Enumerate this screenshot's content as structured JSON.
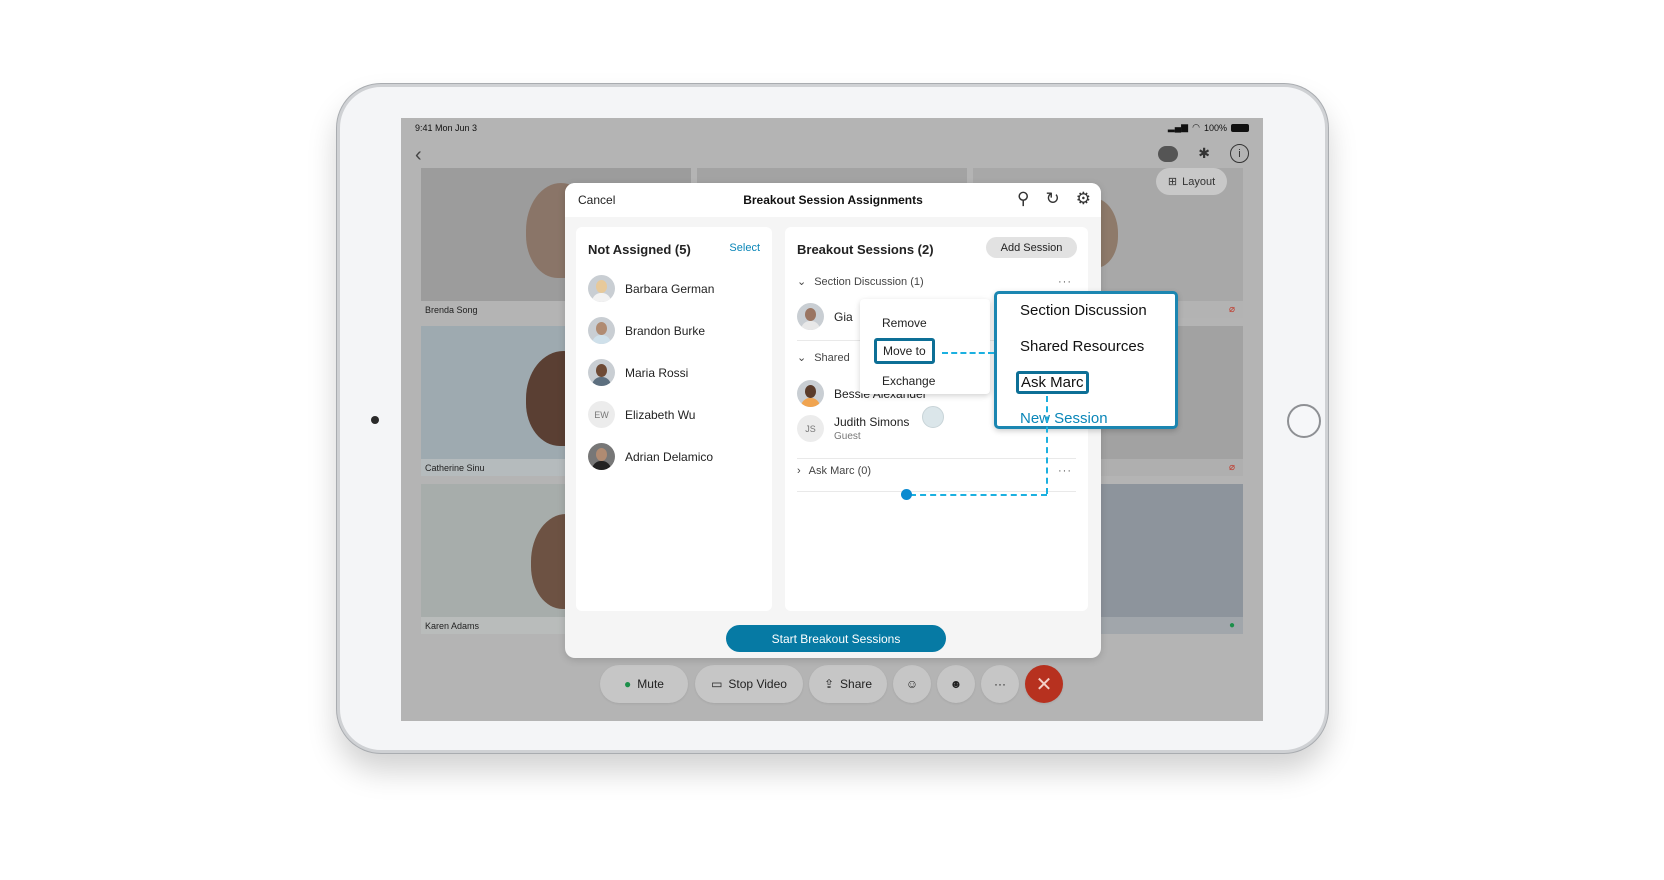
{
  "status": {
    "time": "9:41  Mon Jun 3",
    "battery": "100%"
  },
  "topbar": {
    "back": "‹",
    "bluetooth": "✱",
    "info": "i"
  },
  "layout_button": {
    "icon": "⊞",
    "label": "Layout"
  },
  "tiles": [
    {
      "name": "Brenda Song",
      "mic": ""
    },
    {
      "name": "",
      "mic": ""
    },
    {
      "name": "",
      "mic": "muted"
    },
    {
      "name": "Catherine Sinu",
      "mic": ""
    },
    {
      "name": "",
      "mic": ""
    },
    {
      "name": "",
      "mic": "muted"
    },
    {
      "name": "Karen Adams",
      "mic": ""
    },
    {
      "name": "",
      "mic": ""
    },
    {
      "name": "",
      "mic": "active"
    }
  ],
  "dialog": {
    "cancel": "Cancel",
    "title": "Breakout Session Assignments",
    "icons": [
      "search-icon",
      "refresh-icon",
      "settings-icon"
    ],
    "not_assigned": {
      "title": "Not Assigned (5)",
      "select": "Select",
      "people": [
        {
          "name": "Barbara German",
          "initials": ""
        },
        {
          "name": "Brandon Burke",
          "initials": ""
        },
        {
          "name": "Maria Rossi",
          "initials": ""
        },
        {
          "name": "Elizabeth Wu",
          "initials": "EW"
        },
        {
          "name": "Adrian Delamico",
          "initials": ""
        }
      ]
    },
    "sessions": {
      "title": "Breakout Sessions (2)",
      "add": "Add Session",
      "groups": [
        {
          "label": "Section Discussion (1)",
          "expanded": true,
          "members": [
            {
              "name": "Gia",
              "sub": "",
              "initials": ""
            }
          ]
        },
        {
          "label": "Shared",
          "expanded": true,
          "members": [
            {
              "name": "Bessie Alexander",
              "sub": "",
              "initials": ""
            },
            {
              "name": "Judith Simons",
              "sub": "Guest",
              "initials": "JS"
            }
          ]
        },
        {
          "label": "Ask Marc (0)",
          "expanded": false,
          "members": []
        }
      ],
      "more": "···"
    },
    "start": "Start Breakout Sessions"
  },
  "context_menu": {
    "items": [
      "Remove",
      "Move to",
      "Exchange"
    ],
    "highlighted": "Move to"
  },
  "submenu": {
    "items": [
      "Section Discussion",
      "Shared Resources",
      "Ask Marc",
      "New Session"
    ],
    "highlighted": "Ask Marc"
  },
  "controls": {
    "mute": "Mute",
    "stop_video": "Stop Video",
    "share": "Share",
    "more": "···",
    "end": "✕"
  },
  "colors": {
    "accent": "#067aa4",
    "link": "#0a86b8",
    "end_call": "#b7311f",
    "highlight_border": "#0d6f96",
    "dash": "#1bb0e0"
  }
}
